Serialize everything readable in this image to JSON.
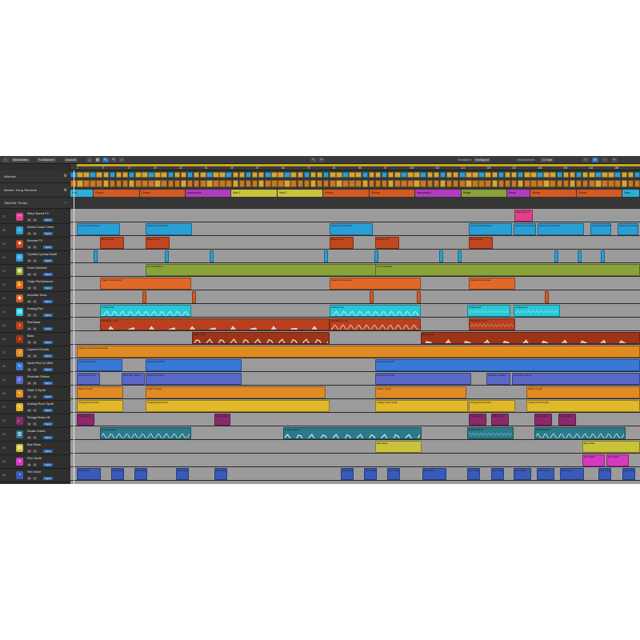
{
  "toolbar": {
    "edit_label": "Bearbeiten",
    "functions_label": "Funktionen",
    "view_label": "Ansicht",
    "snap_label": "Einrasten:",
    "snap_value": "Intelligent",
    "drag_label": "Verschieben:",
    "drag_value": "X-Fade",
    "icons": [
      "back-icon",
      "pointer-icon",
      "pencil-icon",
      "scissors-icon",
      "glue-icon",
      "zoom-icon",
      "catch-icon",
      "grid-icon"
    ]
  },
  "globals": {
    "arrangement_label": "Akkorde",
    "marker_label": "Marker: Song Structure",
    "signature_label": "Takt/Zeit: Tempo"
  },
  "ruler": {
    "bars": [
      "1",
      "9",
      "17",
      "25",
      "33",
      "41",
      "49",
      "57",
      "65",
      "73",
      "81",
      "89",
      "97",
      "105",
      "113",
      "121",
      "129",
      "137",
      "145",
      "153",
      "161",
      "169",
      "177"
    ]
  },
  "markers": [
    {
      "label": "Intro",
      "color": "#2ab0d6"
    },
    {
      "label": "Chorus",
      "color": "#d45a22"
    },
    {
      "label": "Chorus",
      "color": "#d45a22"
    },
    {
      "label": "Instrumental",
      "color": "#b23cc0"
    },
    {
      "label": "Vers 1",
      "color": "#c9c23a"
    },
    {
      "label": "Vers 2",
      "color": "#c9c23a"
    },
    {
      "label": "Chorus",
      "color": "#d45a22"
    },
    {
      "label": "Chorus",
      "color": "#d45a22"
    },
    {
      "label": "Instrumental",
      "color": "#b23cc0"
    },
    {
      "label": "Bridge",
      "color": "#8aa238"
    },
    {
      "label": "Break",
      "color": "#b23cc0"
    },
    {
      "label": "Chorus",
      "color": "#d45a22"
    },
    {
      "label": "Chorus",
      "color": "#d45a22"
    },
    {
      "label": "Outro",
      "color": "#2ab0d6"
    }
  ],
  "tracks": [
    {
      "num": "37",
      "name": "Warp Speed FX",
      "icon": "swoosh-icon",
      "color": "#e0408c"
    },
    {
      "num": "38",
      "name": "Arena Crowd Cheer",
      "icon": "crowd-icon",
      "color": "#2a9fd6"
    },
    {
      "num": "39",
      "name": "Boomer FX",
      "icon": "boom-icon",
      "color": "#c2461f"
    },
    {
      "num": "40",
      "name": "Cymbal Cymbal Swell",
      "icon": "cymbal-icon",
      "color": "#2a9fd6"
    },
    {
      "num": "41",
      "name": "Drum Machine",
      "icon": "drum-machine-icon",
      "color": "#8aa238"
    },
    {
      "num": "42",
      "name": "Claps Performance",
      "icon": "claps-icon",
      "color": "#e0692a"
    },
    {
      "num": "43",
      "name": "Acoustic Toms",
      "icon": "toms-icon",
      "color": "#d45a22"
    },
    {
      "num": "44",
      "name": "Analog Pad",
      "icon": "keyboard-icon",
      "color": "#29c8d8"
    },
    {
      "num": "45",
      "name": "Pad Bass",
      "icon": "bass-icon",
      "color": "#b8401e"
    },
    {
      "num": "46",
      "name": "Bass",
      "icon": "bass-icon",
      "color": "#9c3418"
    },
    {
      "num": "47",
      "name": "Layered Chords",
      "icon": "chords-icon",
      "color": "#e08a24"
    },
    {
      "num": "48",
      "name": "Synth Pizz 01 MIDI",
      "icon": "synth-icon",
      "color": "#3a78d8"
    },
    {
      "num": "49",
      "name": "Pizzicato Strikes",
      "icon": "strings-icon",
      "color": "#5a68c8"
    },
    {
      "num": "50",
      "name": "SAW X Synth",
      "icon": "synth-icon",
      "color": "#e08a24"
    },
    {
      "num": "51",
      "name": "Analog Pluck Synth",
      "icon": "synth-icon",
      "color": "#e0b82a"
    },
    {
      "num": "52",
      "name": "Shrugy Brass Hit",
      "icon": "brass-icon",
      "color": "#8a2a6a"
    },
    {
      "num": "53",
      "name": "Studio Grand",
      "icon": "piano-icon",
      "color": "#2a7a8a"
    },
    {
      "num": "54",
      "name": "Bas Pinks",
      "icon": "keyboard-icon",
      "color": "#c9c23a"
    },
    {
      "num": "55",
      "name": "Pizz Synth",
      "icon": "synth-icon",
      "color": "#d43ac0"
    },
    {
      "num": "56",
      "name": "Hex Voice",
      "icon": "voice-icon",
      "color": "#3a5ab8"
    },
    {
      "num": "57",
      "name": "Not Assigned",
      "icon": "",
      "color": "#555555"
    }
  ],
  "track_buttons": {
    "mute": "M",
    "solo": "S",
    "sync": "Sync"
  },
  "regions": {
    "warp": "Warp Speed",
    "crowd": "Arena Crowd Cheer",
    "boomer": "Boomer FX",
    "drum": "Drum Machine",
    "claps": "Claps Performance",
    "toms": "Toms",
    "pad": "Analog Pad",
    "padbass": "Pad Bass (+12)",
    "bass": "Bass (+12)",
    "chords": "Layered Chords Automation",
    "pizz": "Synth Pizz 01 M",
    "strikes": "Pizzicato Strikes",
    "saw": "SAW X Synth",
    "pluck": "Analog Pluck Synth",
    "brass": "Shrugy Brs",
    "grand": "Studio Grand",
    "baspinks": "Bas Pinks",
    "pizzsynth": "Pizz Synth",
    "voice": "Hex Voice"
  },
  "colors": {
    "accent": "#2f6fb8",
    "cycle": "#c6a81f",
    "lane_bg": "#9b9b9b"
  }
}
